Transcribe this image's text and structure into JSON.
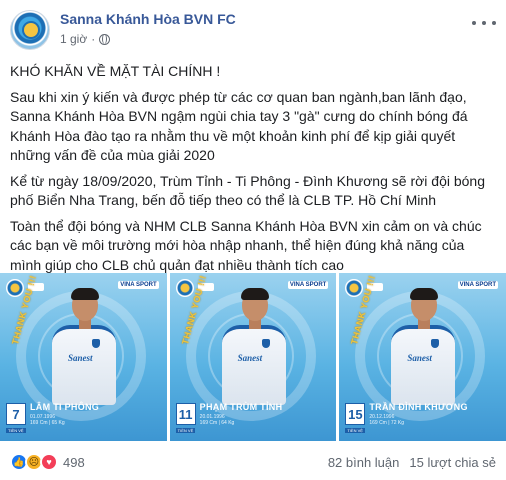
{
  "post": {
    "page_name": "Sanna Khánh Hòa BVN FC",
    "time": "1 giờ",
    "separator": "·",
    "paragraphs": [
      "KHÓ KHĂN VỀ MẶT TÀI CHÍNH !",
      "Sau khi xin ý kiến và được phép từ các cơ quan ban ngành,ban lãnh đạo, Sanna Khánh Hòa BVN ngậm ngùi chia tay 3 \"gà\" cưng do chính bóng đá Khánh Hòa đào tạo ra nhằm thu về một khoản kinh phí để kịp giải quyết những vấn đề của mùa giải 2020",
      "Kể từ ngày 18/09/2020, Trùm Tỉnh - Ti Phông - Đình Khương sẽ rời đội bóng phố Biển Nha Trang, bến đỗ tiếp theo có thể là CLB TP. Hồ Chí Minh",
      "Toàn thể đội bóng và NHM CLB Sanna Khánh Hòa BVN xin cảm on và chúc các bạn về môi trường mới hòa nhập nhanh, thể hiện đúng khả năng của mình giúp cho CLB chủ quản đạt nhiều thành tích cao"
    ]
  },
  "images": [
    {
      "thanks": "THANK YOU !!!",
      "number": "7",
      "name": "LÂM TI PHÔNG",
      "info_line1": "01.07.1996",
      "info_line2": "169 Cm | 65 Kg",
      "position": "TIỀN VỆ",
      "jersey_brand": "Sanest",
      "sponsor": "VINA SPORT"
    },
    {
      "thanks": "THANK YOU !!!",
      "number": "11",
      "name": "PHẠM TRÙM TỈNH",
      "info_line1": "20.01.1996",
      "info_line2": "169 Cm | 64 Kg",
      "position": "TIỀN VỆ",
      "jersey_brand": "Sanest",
      "sponsor": "VINA SPORT"
    },
    {
      "thanks": "THANK YOU !!!",
      "number": "15",
      "name": "TRẦN ĐÌNH KHƯƠNG",
      "info_line1": "20.12.1996",
      "info_line2": "169 Cm | 72 Kg",
      "position": "TIỀN VỆ",
      "jersey_brand": "Sanest",
      "sponsor": "VINA SPORT"
    }
  ],
  "footer": {
    "reaction_count": "498",
    "comments": "82 bình luận",
    "shares": "15 lượt chia sẻ"
  },
  "colors": {
    "page_name": "#385898",
    "like": "#1877f2",
    "love": "#f33e58",
    "sad": "#f7b125",
    "image_bg": "#5ab3e3",
    "thanks_text": "#f0c43a"
  },
  "icons": {
    "reactions": [
      "like-icon",
      "sad-icon",
      "love-icon"
    ],
    "privacy": "globe-icon",
    "menu": "more-icon"
  }
}
